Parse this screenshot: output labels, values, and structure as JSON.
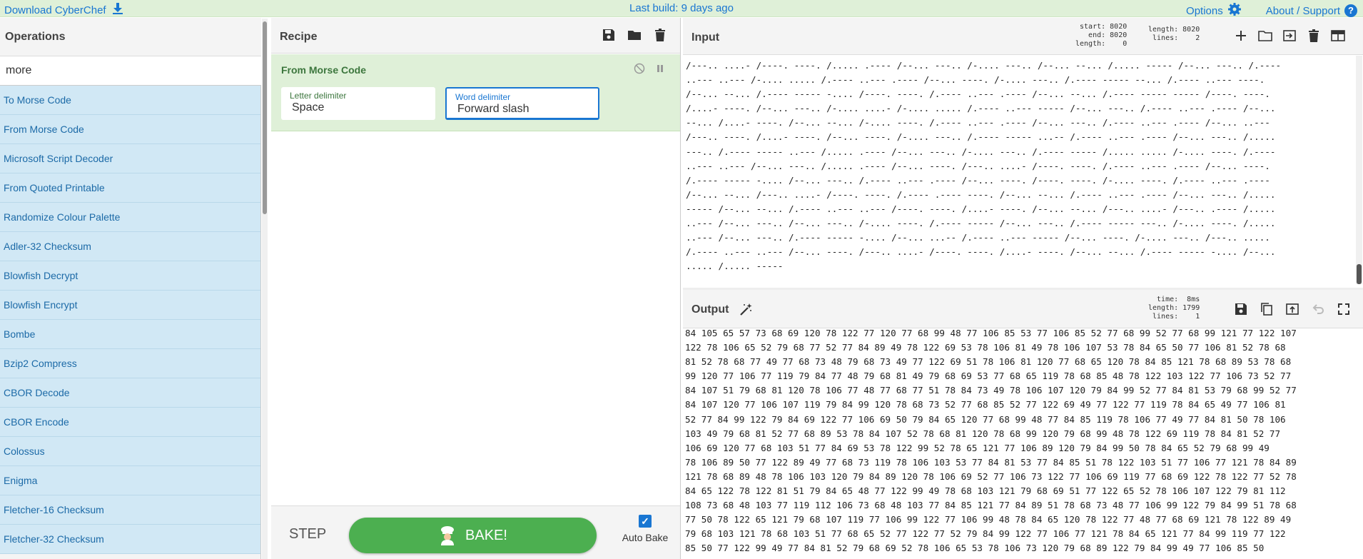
{
  "banner": {
    "download": "Download CyberChef",
    "build": "Last build: 9 days ago",
    "options": "Options",
    "about": "About / Support"
  },
  "operations": {
    "title": "Operations",
    "search_value": "more",
    "items": [
      "To Morse Code",
      "From Morse Code",
      "Microsoft Script Decoder",
      "From Quoted Printable",
      "Randomize Colour Palette",
      "Adler-32 Checksum",
      "Blowfish Decrypt",
      "Blowfish Encrypt",
      "Bombe",
      "Bzip2 Compress",
      "CBOR Decode",
      "CBOR Encode",
      "Colossus",
      "Enigma",
      "Fletcher-16 Checksum",
      "Fletcher-32 Checksum"
    ]
  },
  "recipe": {
    "title": "Recipe",
    "operation": {
      "name": "From Morse Code",
      "letter_delimiter_label": "Letter delimiter",
      "letter_delimiter_value": "Space",
      "word_delimiter_label": "Word delimiter",
      "word_delimiter_value": "Forward slash"
    },
    "step": "STEP",
    "bake": "BAKE!",
    "auto_bake": "Auto Bake",
    "auto_bake_checked": true
  },
  "input": {
    "title": "Input",
    "stats_1": "start: 8020\n  end: 8020\nlength:    0",
    "stats_2": "length: 8020\n lines:    2",
    "lines": [
      "/---.. ....- /----. ----. /..... .---- /--... ---.. /-.... ---.. /--... --... /..... ----- /--... ---.. /.----",
      "..--- ..--- /-.... ..... /.---- ..--- .---- /--... ----. /-.... ---.. /.---- ----- --... /.---- ..--- ----.",
      "/--... --... /.---- ----- -.... /----. ----. /.---- ..--- .---- /--... --... /.---- ----- ----- /----. ----.",
      "/....- ----. /--... ---.. /-.... ....- /-.... ..... /.---- ..--- ----- /--... ---.. /.---- ..--- .---- /--...",
      "--... /....- ----. /--... --... /-.... ----. /.---- ..--- .---- /--... ---.. /.---- ..--- .---- /--... ..---",
      "/---.. ----. /....- ----. /--... ----. /-.... ---.. /.---- ----- ...-- /.---- ..--- .---- /--... ---.. /.....",
      "---.. /.---- ----- ..--- /..... .---- /--... ---.. /-.... ---.. /.---- ----- /..... ..... /-.... ----. /.----",
      "..--- ..--- /--... ---.. /..... .---- /--... ----. /---.. ....- /----. ----. /.---- ..--- .---- /--... ----.",
      "/.---- ----- -.... /--... ---.. /.---- ..--- .---- /--... ----. /----. ----. /-.... ----. /.---- ..--- .----",
      "/--... --... /---.. ....- /----. ----. /.---- .---- ----. /--... --... /.---- ..--- .---- /--... ---.. /.....",
      "----- /--... --... /.---- ..--- ..--- /----. ----. /....- ----. /--... --... /---.. ....- /---.. .---- /.....",
      "..--- /--... ---.. /--... ---.. /-.... ----. /.---- ----- /--... ---.. /.---- ----- ---.. /-.... ----. /.....",
      "..--- /--... ---.. /.---- ----- -.... /--... ...-- /.---- ..--- ----- /--... ----. /-.... ---.. /---.. .....",
      "/.---- ..--- ..--- /--... ----. /---.. ....- /----. ----. /....- ----. /--... --... /.---- ----- -.... /--...",
      "..... /..... -----"
    ]
  },
  "output": {
    "title": "Output",
    "stats": "  time:  8ms\nlength: 1799\n lines:    1",
    "lines": [
      "84 105 65 57 73 68 69 120 78 122 77 120 77 68 99 48 77 106 85 53 77 106 85 52 77 68 99 52 77 68 99 121 77 122 107",
      "122 78 106 65 52 79 68 77 52 77 84 89 49 78 122 69 53 78 106 81 49 78 106 107 53 78 84 65 50 77 106 81 52 78 68",
      "81 52 78 68 77 49 77 68 73 48 79 68 73 49 77 122 69 51 78 106 81 120 77 68 65 120 78 84 85 121 78 68 89 53 78 68",
      "99 120 77 106 77 119 79 84 77 48 79 68 81 49 79 68 69 53 77 68 65 119 78 68 85 48 78 122 103 122 77 106 73 52 77",
      "84 107 51 79 68 81 120 78 106 77 48 77 68 77 51 78 84 73 49 78 106 107 120 79 84 99 52 77 84 81 53 79 68 99 52 77",
      "84 107 120 77 106 107 119 79 84 99 120 78 68 73 52 77 68 85 52 77 122 69 49 77 122 77 119 78 84 65 49 77 106 81",
      "52 77 84 99 122 79 84 69 122 77 106 69 50 79 84 65 120 77 68 99 48 77 84 85 119 78 106 77 49 77 84 81 50 78 106",
      "103 49 79 68 81 52 77 68 89 53 78 84 107 52 78 68 81 120 78 68 99 120 79 68 99 48 78 122 69 119 78 84 81 52 77",
      "106 69 120 77 68 103 51 77 84 69 53 78 122 99 52 78 65 121 77 106 89 120 79 84 99 50 78 84 65 52 79 68 99 49",
      "78 106 89 50 77 122 89 49 77 68 73 119 78 106 103 53 77 84 81 53 77 84 85 51 78 122 103 51 77 106 77 121 78 84 89",
      "121 78 68 89 48 78 106 103 120 79 84 89 120 78 106 69 52 77 106 73 122 77 106 69 119 77 68 69 122 78 122 77 52 78",
      "84 65 122 78 122 81 51 79 84 65 48 77 122 99 49 78 68 103 121 79 68 69 51 77 122 65 52 78 106 107 122 79 81 112",
      "108 73 68 48 103 77 119 112 106 73 68 48 103 77 84 85 121 77 84 89 51 78 68 73 48 77 106 99 122 79 84 99 51 78 68",
      "77 50 78 122 65 121 79 68 107 119 77 106 99 122 77 106 99 48 78 84 65 120 78 122 77 48 77 68 69 121 78 122 89 49",
      "79 68 103 121 78 68 103 51 77 68 65 52 77 122 77 52 79 84 99 122 77 106 77 121 78 84 65 121 77 84 99 119 77 122",
      "85 50 77 122 99 49 77 84 81 52 79 68 69 52 78 106 65 53 78 106 73 120 79 68 89 122 79 84 99 49 77 106 85 50"
    ]
  }
}
